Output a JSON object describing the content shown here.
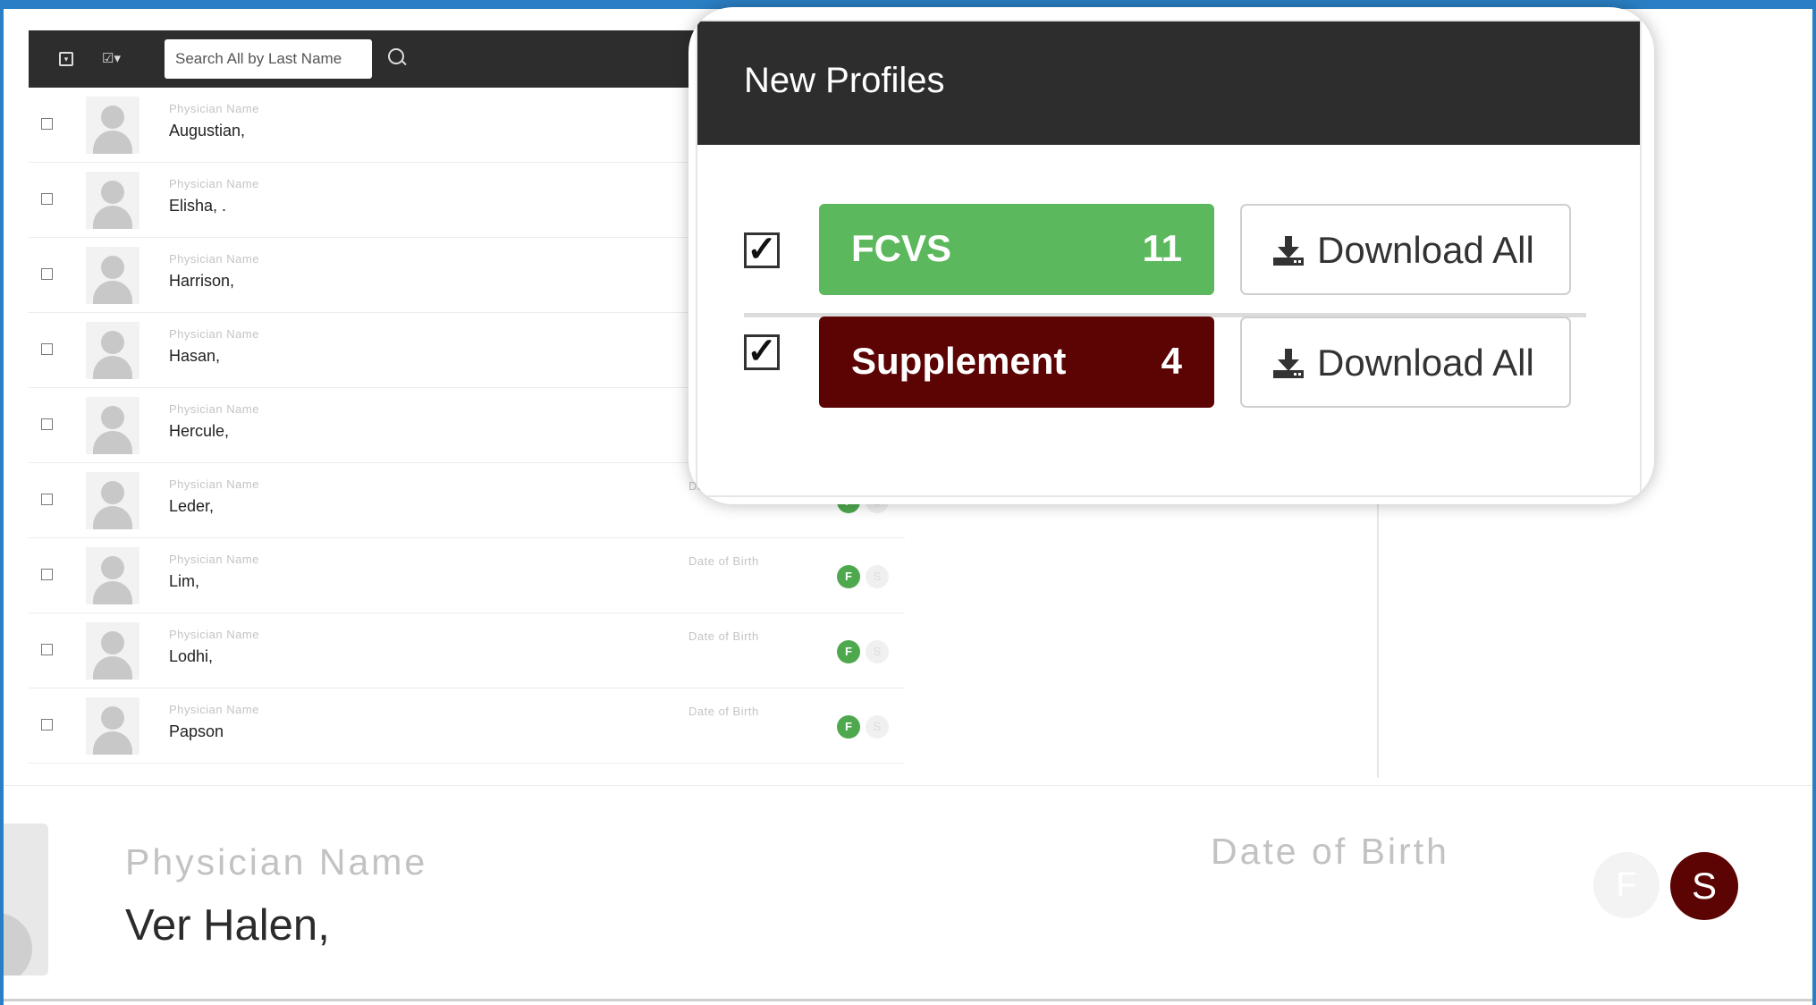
{
  "colors": {
    "brand_bar": "#2a7fc4",
    "header_dark": "#2d2d2d",
    "fcvs_green": "#5cb85c",
    "supplement_red": "#5c0303",
    "badge_green": "#4ea84e"
  },
  "list": {
    "toolbar": {
      "expand_icon": "square-expand-icon",
      "check_menu_icon": "check-dropdown-icon",
      "search_placeholder": "Search All by Last Name",
      "search_icon": "search-icon"
    },
    "field_label": "Physician Name",
    "dob_label": "Date of Birth",
    "badge_f": "F",
    "badge_s": "S",
    "rows": [
      {
        "name": "Augustian,"
      },
      {
        "name": "Elisha, ."
      },
      {
        "name": "Harrison,"
      },
      {
        "name": "Hasan,"
      },
      {
        "name": "Hercule,"
      },
      {
        "name": "Leder,"
      },
      {
        "name": "Lim,"
      },
      {
        "name": "Lodhi,"
      },
      {
        "name": "Papson"
      }
    ]
  },
  "zoom_row": {
    "field_label": "Physician Name",
    "name": "Ver Halen,",
    "dob_label": "Date of Birth",
    "badge_f": "F",
    "badge_s": "S"
  },
  "popup": {
    "title": "New Profiles",
    "items": [
      {
        "label": "FCVS",
        "count": "11",
        "checked": true,
        "button": "Download All"
      },
      {
        "label": "Supplement",
        "count": "4",
        "checked": true,
        "button": "Download All"
      }
    ]
  }
}
